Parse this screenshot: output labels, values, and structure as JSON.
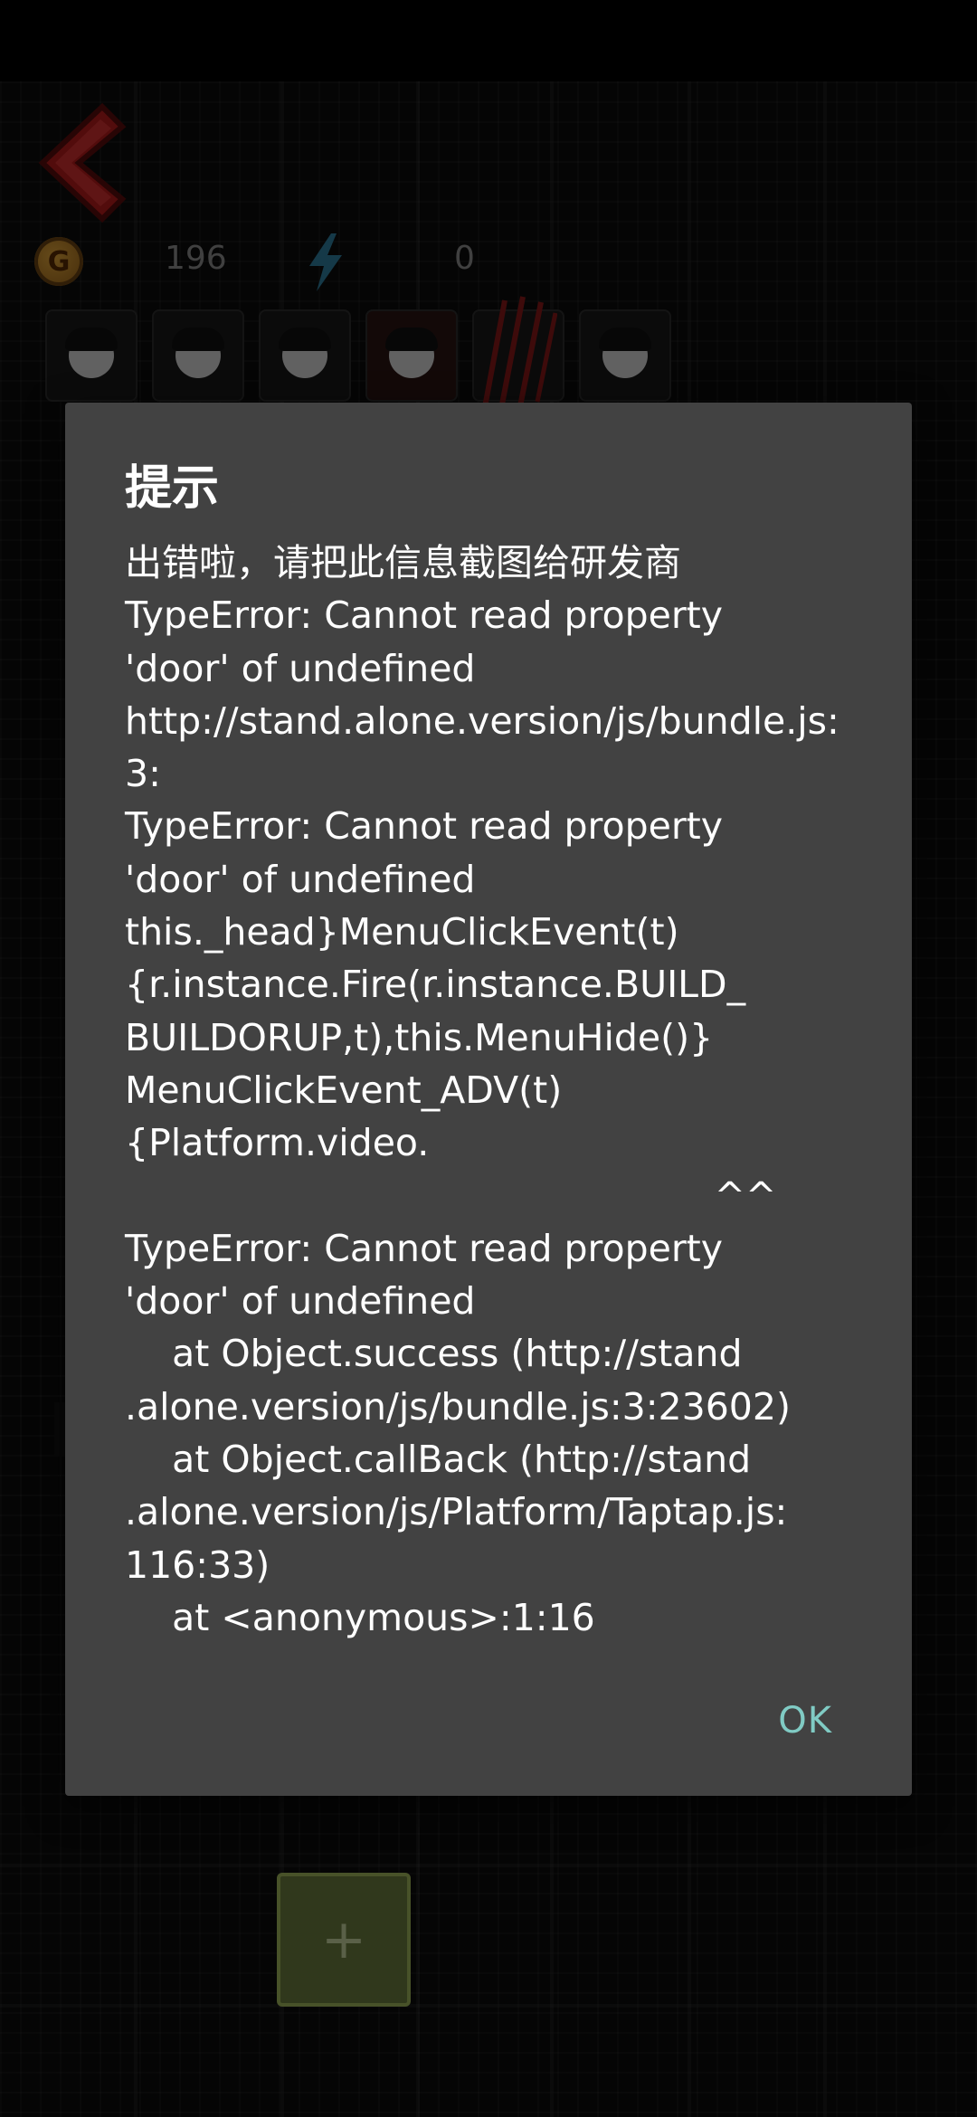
{
  "game": {
    "gold_value": "196",
    "energy_value": "0",
    "coin_glyph": "G",
    "add_glyph": "+",
    "icons": [
      "back-arrow-icon",
      "gold-coin-icon",
      "lightning-bolt-icon",
      "claw-scratch-icon"
    ]
  },
  "dialog": {
    "title": "提示",
    "lines": [
      "出错啦，请把此信息截图给研发商",
      "TypeError: Cannot read property",
      "'door' of undefined",
      "http://stand.alone.version/js/bundle.js:",
      "3:",
      "TypeError: Cannot read property",
      "'door' of undefined",
      "this._head}MenuClickEvent(t)",
      "{r.instance.Fire(r.instance.BUILD_",
      "BUILDORUP,t),this.MenuHide()}",
      "MenuClickEvent_ADV(t)",
      "{Platform.video.",
      "                                                  ^^",
      "TypeError: Cannot read property",
      "'door' of undefined",
      "    at Object.success (http://stand",
      ".alone.version/js/bundle.js:3:23602)",
      "    at Object.callBack (http://stand",
      ".alone.version/js/Platform/Taptap.js:",
      "116:33)",
      "    at <anonymous>:1:16"
    ],
    "ok_label": "OK"
  },
  "colors": {
    "dialog_bg": "#424242",
    "accent": "#80cbc4",
    "back_arrow": "#c62828",
    "energy": "#2f7fa0"
  }
}
